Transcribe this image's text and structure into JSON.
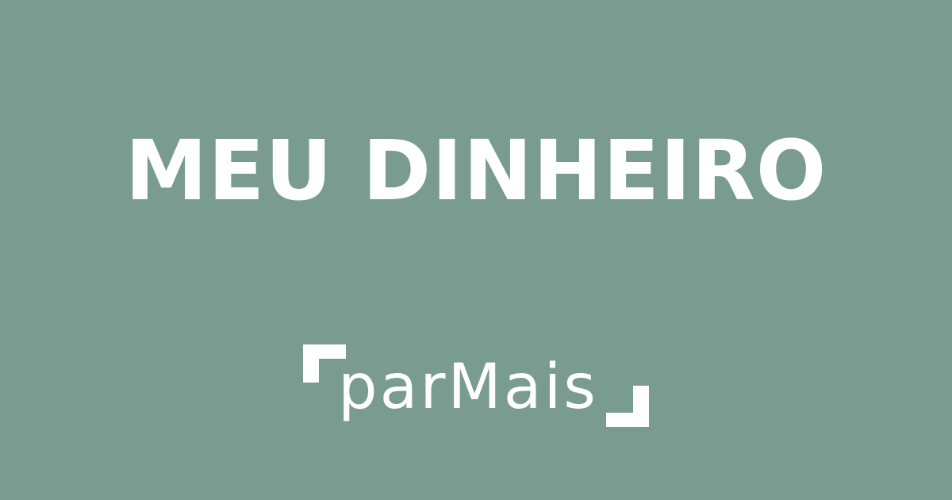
{
  "headline": "MEU DINHEIRO",
  "brand": {
    "name": "parMais",
    "logo_icon": "bracket-corner-logo"
  },
  "colors": {
    "background": "#7a9c90",
    "foreground": "#ffffff"
  }
}
